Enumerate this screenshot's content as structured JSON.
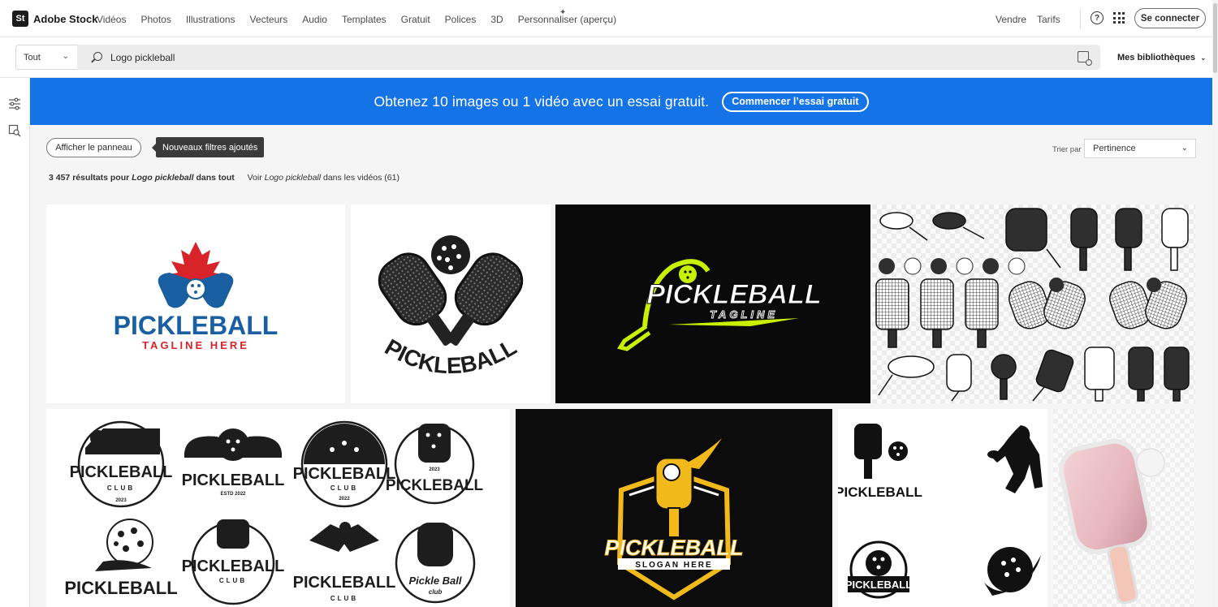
{
  "app": {
    "logo_mark": "St",
    "name": "Adobe Stock"
  },
  "nav": {
    "links": [
      "Vidéos",
      "Photos",
      "Illustrations",
      "Vecteurs",
      "Audio",
      "Templates",
      "Gratuit",
      "Polices",
      "3D",
      "Personnaliser (aperçu)"
    ],
    "sell": "Vendre",
    "pricing": "Tarifs",
    "help_icon": "help-icon",
    "apps_icon": "apps-grid-icon",
    "signin": "Se connecter"
  },
  "search": {
    "scope": "Tout",
    "query": "Logo pickleball",
    "libraries": "Mes bibliothèques"
  },
  "promo": {
    "text": "Obtenez 10 images ou 1 vidéo avec un essai gratuit.",
    "button": "Commencer l’essai gratuit",
    "color": "#1473e6"
  },
  "filters": {
    "show_panel": "Afficher le panneau",
    "tooltip": "Nouveaux filtres ajoutés",
    "sort_label": "Trier par",
    "sort_value": "Pertinence"
  },
  "results": {
    "count": "3 457 résultats pour",
    "query": "Logo pickleball",
    "scope": "dans tout",
    "video_prefix": "Voir",
    "video_query": "Logo pickleball",
    "video_suffix": "dans les vidéos (61)"
  },
  "tiles": {
    "t1": {
      "title": "PICKLEBALL",
      "tagline": "TAGLINE HERE"
    },
    "t2": {
      "title": "PICKLEBALL"
    },
    "t3": {
      "title": "PICKLEBALL",
      "tagline": "TAGLINE"
    },
    "t5": {
      "b1": "PICKLEBALL",
      "b1_sub": "CLUB",
      "b1_year": "2023",
      "b2": "PICKLEBALL",
      "b2_year": "ESTD 2022",
      "b3": "PICKLEBALL",
      "b3_sub": "CLUB",
      "b3_year": "2022",
      "b4": "PICKLEBALL",
      "b4_year": "2023",
      "b5": "PICKLEBALL",
      "b6": "PICKLEBALL",
      "b6_sub": "CLUB",
      "b7": "PICKLEBALL",
      "b7_sub": "CLUB",
      "b8": "Pickle Ball",
      "b8_sub": "club"
    },
    "t6": {
      "title": "PICKLEBALL",
      "tagline": "SLOGAN HERE"
    },
    "t7": {
      "title1": "PICKLEBALL",
      "title2": "PICKLEBALL"
    }
  }
}
